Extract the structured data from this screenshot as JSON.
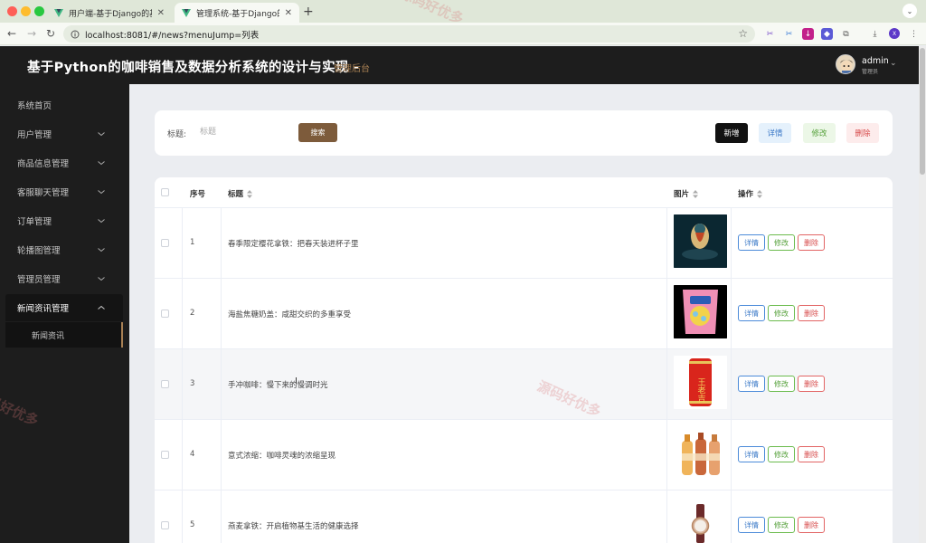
{
  "browser": {
    "tabs": [
      {
        "title": "用户端-基于Django的基于Pyt",
        "active": false
      },
      {
        "title": "管理系统-基于Django的基于Py",
        "active": true
      }
    ],
    "close_glyph": "✕",
    "new_tab_glyph": "+",
    "url": "localhost:8081/#/news?menuJump=列表",
    "profile_initial": "X"
  },
  "header": {
    "title": "基于Python的咖啡销售及数据分析系统的设计与实现 -",
    "subtitle": "管理后台",
    "user_name": "admin",
    "user_role": "管理员"
  },
  "sidebar": {
    "items": [
      {
        "label": "系统首页",
        "has_children": false
      },
      {
        "label": "用户管理",
        "has_children": true
      },
      {
        "label": "商品信息管理",
        "has_children": true
      },
      {
        "label": "客服聊天管理",
        "has_children": true
      },
      {
        "label": "订单管理",
        "has_children": true
      },
      {
        "label": "轮播图管理",
        "has_children": true
      },
      {
        "label": "管理员管理",
        "has_children": true
      },
      {
        "label": "新闻资讯管理",
        "has_children": true,
        "open": true
      }
    ],
    "active_sub": "新闻资讯"
  },
  "search": {
    "label": "标题:",
    "placeholder": "标题",
    "button": "搜索"
  },
  "actions": {
    "add": "新增",
    "detail": "详情",
    "edit": "修改",
    "delete": "删除"
  },
  "table": {
    "columns": {
      "index": "序号",
      "title": "标题",
      "image": "图片",
      "ops": "操作"
    },
    "rows": [
      {
        "index": "1",
        "title": "春季限定樱花拿铁：把春天装进杯子里"
      },
      {
        "index": "2",
        "title": "海盐焦糖奶盖：咸甜交织的多重享受"
      },
      {
        "index": "3",
        "title": "手冲咖啡：慢下来的慢调时光"
      },
      {
        "index": "4",
        "title": "意式浓缩：咖啡灵魂的浓缩呈现"
      },
      {
        "index": "5",
        "title": "燕麦拿铁：开启植物基生活的健康选择"
      }
    ],
    "row_ops": {
      "detail": "详情",
      "edit": "修改",
      "delete": "删除"
    }
  },
  "product_text": {
    "can_brand": "王老吉"
  },
  "watermark": "源码好优多",
  "colors": {
    "accent": "#7d5b3b",
    "sidebar_bg": "#1d1d1d",
    "detail": "#3a78c7",
    "edit": "#55a03a",
    "delete": "#d74a4a"
  }
}
